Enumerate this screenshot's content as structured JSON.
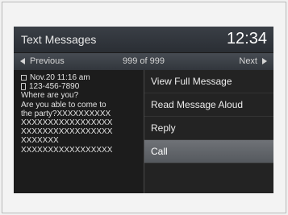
{
  "header": {
    "title": "Text Messages",
    "clock": "12:34"
  },
  "nav": {
    "previous_label": "Previous",
    "counter": "999 of 999",
    "next_label": "Next"
  },
  "message": {
    "timestamp": "Nov.20 11:16 am",
    "phone": "123-456-7890",
    "lines": [
      "Where are you?",
      "Are you able to come to",
      "the party?XXXXXXXXXX",
      "XXXXXXXXXXXXXXXXX",
      "XXXXXXXXXXXXXXXXX",
      "XXXXXXX",
      "XXXXXXXXXXXXXXXXX"
    ]
  },
  "menu": {
    "items": [
      "View Full Message",
      "Read Message Aloud",
      "Reply",
      "Call"
    ],
    "selected_index": 3
  }
}
